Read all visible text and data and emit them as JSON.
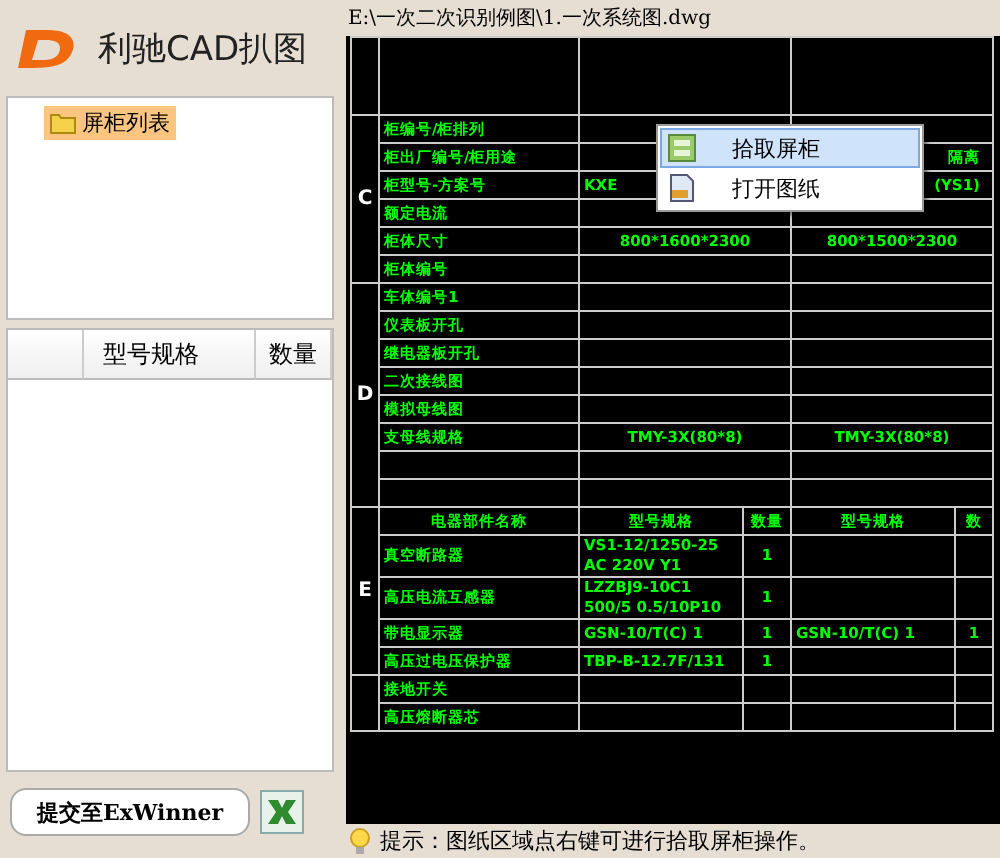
{
  "app": {
    "title": "利驰CAD扒图"
  },
  "tree": {
    "items": [
      {
        "label": "屏柜列表",
        "selected": true
      }
    ]
  },
  "grid": {
    "columns": [
      "型号规格",
      "数量"
    ]
  },
  "submit_button": {
    "label": "提交至ExWinner"
  },
  "file_path": "E:\\一次二次识别例图\\1.一次系统图.dwg",
  "drawing": {
    "sections": [
      {
        "rows": [
          {
            "kind": "spacer"
          }
        ]
      },
      {
        "letter": "C",
        "rows": [
          {
            "kind": "field",
            "label": "柜编号/柜排列"
          },
          {
            "kind": "covered",
            "label": "柜出厂编号/柜用途",
            "value_2": "隔离"
          },
          {
            "kind": "covered",
            "label": "柜型号-方案号",
            "value_1": "KXE",
            "value_2": "(YS1)"
          },
          {
            "kind": "field",
            "label": "额定电流"
          },
          {
            "kind": "field",
            "label": "柜体尺寸",
            "value_1": "800*1600*2300",
            "value_2": "800*1500*2300"
          },
          {
            "kind": "field",
            "label": "柜体编号"
          }
        ]
      },
      {
        "letter": "D",
        "rows": [
          {
            "kind": "field",
            "label": "车体编号1"
          },
          {
            "kind": "field",
            "label": "仪表板开孔"
          },
          {
            "kind": "field",
            "label": "继电器板开孔"
          },
          {
            "kind": "field",
            "label": "二次接线图"
          },
          {
            "kind": "field",
            "label": "模拟母线图"
          },
          {
            "kind": "field",
            "label": "支母线规格",
            "value_1": "TMY-3X(80*8)",
            "value_2": "TMY-3X(80*8)"
          },
          {
            "kind": "blank"
          },
          {
            "kind": "blank"
          }
        ]
      },
      {
        "letter": "E",
        "rows": [
          {
            "kind": "header",
            "columns": [
              "电器部件名称",
              "型号规格",
              "数量",
              "型号规格",
              "数"
            ]
          },
          {
            "kind": "part",
            "name": "真空断路器",
            "model": "VS1-12/1250-25 AC 220V Y1",
            "qty": "1"
          },
          {
            "kind": "part",
            "name": "高压电流互感器",
            "model": "LZZBJ9-10C1 500/5 0.5/10P10",
            "qty": "1"
          },
          {
            "kind": "part",
            "name": "带电显示器",
            "model": "GSN-10/T(C) 1",
            "qty": "1",
            "model_2": "GSN-10/T(C) 1",
            "qty_2": "1"
          },
          {
            "kind": "part",
            "name": "高压过电压保护器",
            "model": "TBP-B-12.7F/131",
            "qty": "1"
          }
        ]
      },
      {
        "rows": [
          {
            "kind": "part",
            "name": "接地开关"
          },
          {
            "kind": "part",
            "name": "高压熔断器芯"
          }
        ]
      }
    ]
  },
  "context_menu": {
    "items": [
      {
        "label": "拾取屏柜",
        "selected": true
      },
      {
        "label": "打开图纸",
        "selected": false
      }
    ]
  },
  "status_bar": {
    "hint": "提示：图纸区域点右键可进行拾取屏柜操作。"
  }
}
